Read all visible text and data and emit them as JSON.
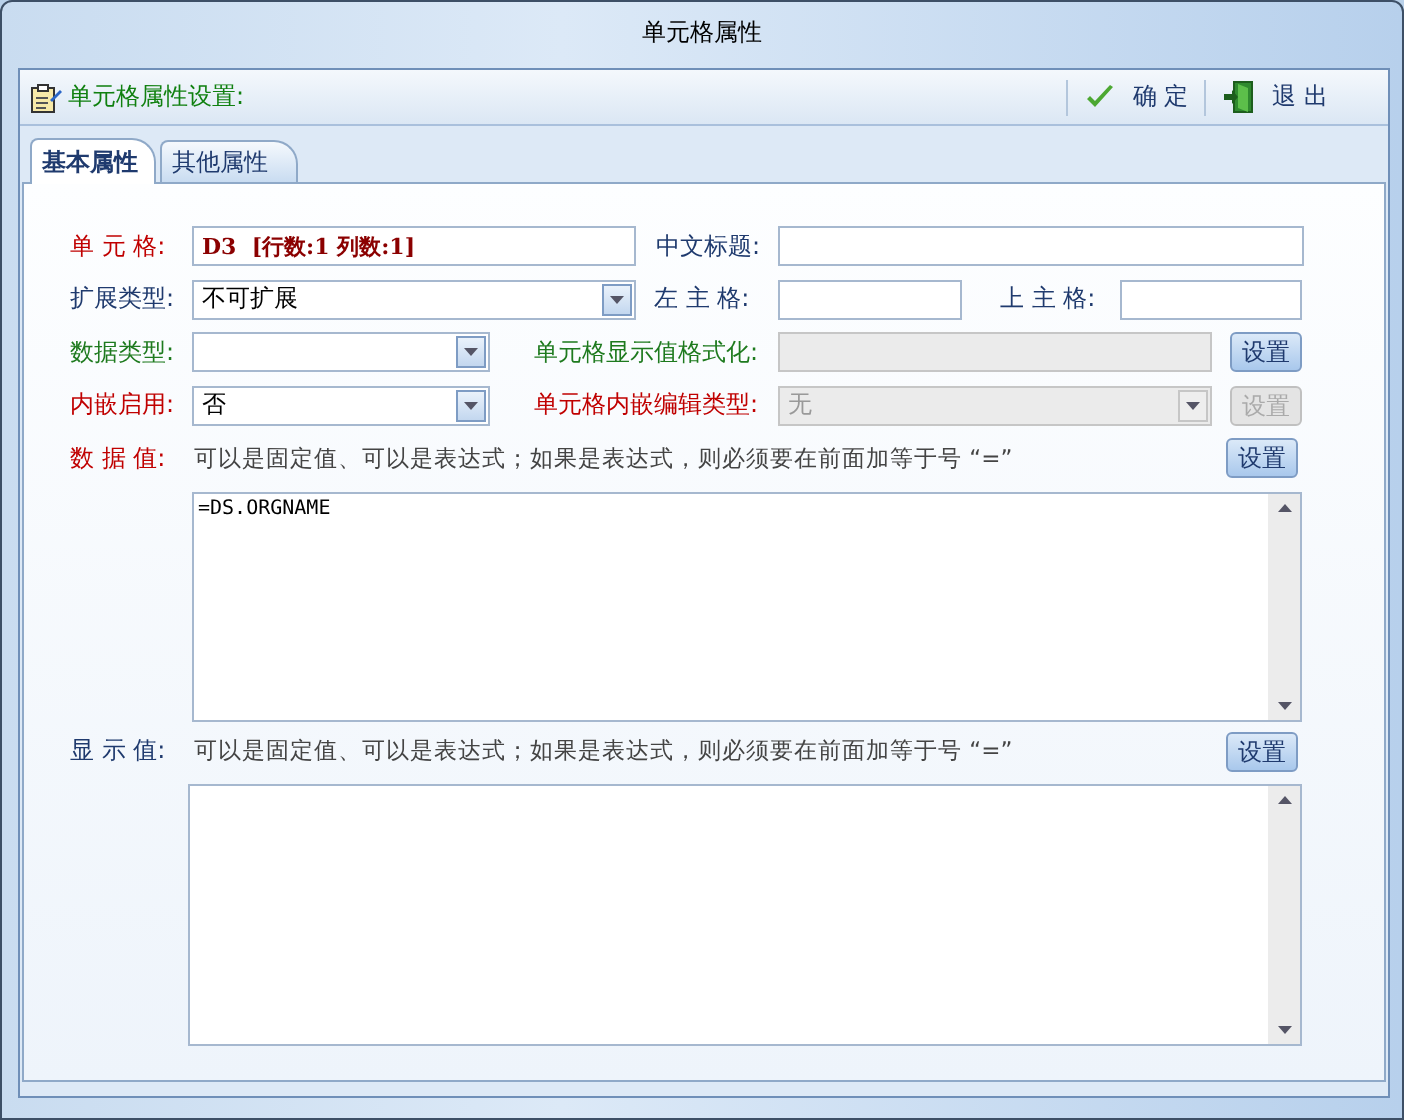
{
  "window": {
    "title": "单元格属性"
  },
  "toolbar": {
    "title": "单元格属性设置:",
    "buttons": [
      {
        "kind": "ok",
        "label": "确 定"
      },
      {
        "kind": "exit",
        "label": "退 出"
      }
    ]
  },
  "tabs": [
    {
      "label": "基本属性",
      "selected": true
    },
    {
      "label": "其他属性",
      "selected": false
    }
  ],
  "rows": [
    [
      {
        "kind": "label",
        "text": "单 元 格:",
        "color": "#c00000"
      },
      {
        "kind": "text",
        "value": "D3  [行数:1 列数:1]",
        "bold": true,
        "disabled": false
      },
      {
        "kind": "label",
        "text": "中文标题:",
        "color": "#1f3a6e"
      },
      {
        "kind": "text",
        "disabled": false
      }
    ],
    [
      {
        "kind": "label",
        "text": "扩展类型:",
        "color": "#1f3a6e"
      },
      {
        "kind": "combo",
        "value": "不可扩展",
        "disabled": false
      },
      {
        "kind": "label",
        "text": "左 主 格:",
        "color": "#1f3a6e"
      },
      {
        "kind": "text",
        "disabled": false
      },
      {
        "kind": "label",
        "text": "上 主 格:",
        "color": "#1f3a6e"
      },
      {
        "kind": "text",
        "disabled": false
      }
    ],
    [
      {
        "kind": "label",
        "text": "数据类型:",
        "color": "#1e7a1e"
      },
      {
        "kind": "combo",
        "disabled": false
      },
      {
        "kind": "label",
        "text": "单元格显示值格式化:",
        "color": "#1e7a1e"
      },
      {
        "kind": "text",
        "disabled": true
      },
      {
        "kind": "button",
        "text": "设置",
        "disabled": false
      }
    ],
    [
      {
        "kind": "label",
        "text": "内嵌启用:",
        "color": "#c00000"
      },
      {
        "kind": "combo",
        "value": "否",
        "disabled": false
      },
      {
        "kind": "label",
        "text": "单元格内嵌编辑类型:",
        "color": "#c00000"
      },
      {
        "kind": "combo",
        "value": "无",
        "disabled": true
      },
      {
        "kind": "button",
        "text": "设置",
        "disabled": true
      }
    ]
  ],
  "expressions": [
    {
      "label": "数 据 值:",
      "color": "#c00000",
      "hint": "可以是固定值、可以是表达式；如果是表达式，则必须要在前面加等于号 “=”",
      "button": "设置",
      "value": "=DS.ORGNAME"
    },
    {
      "label": "显 示 值:",
      "color": "#1f3a6e",
      "hint": "可以是固定值、可以是表达式；如果是表达式，则必须要在前面加等于号 “=”",
      "button": "设置"
    }
  ]
}
